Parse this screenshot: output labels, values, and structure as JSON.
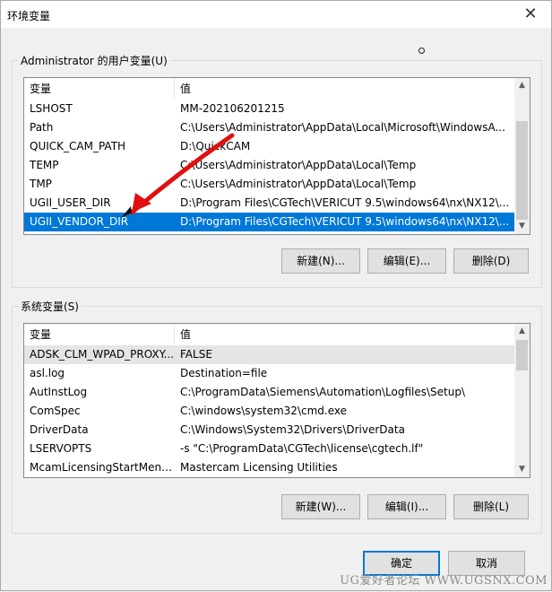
{
  "window": {
    "title": "环境变量",
    "close_glyph": "✕"
  },
  "user_group": {
    "label": "Administrator 的用户变量(U)",
    "col_name": "变量",
    "col_value": "值",
    "rows": [
      {
        "name": "LSHOST",
        "value": "MM-202106201215"
      },
      {
        "name": "Path",
        "value": "C:\\Users\\Administrator\\AppData\\Local\\Microsoft\\WindowsA..."
      },
      {
        "name": "QUICK_CAM_PATH",
        "value": "D:\\QuickCAM"
      },
      {
        "name": "TEMP",
        "value": "C:\\Users\\Administrator\\AppData\\Local\\Temp"
      },
      {
        "name": "TMP",
        "value": "C:\\Users\\Administrator\\AppData\\Local\\Temp"
      },
      {
        "name": "UGII_USER_DIR",
        "value": "D:\\Program Files\\CGTech\\VERICUT 9.5\\windows64\\nx\\NX12\\..."
      },
      {
        "name": "UGII_VENDOR_DIR",
        "value": "D:\\Program Files\\CGTech\\VERICUT 9.5\\windows64\\nx\\NX12\\..."
      }
    ],
    "new_label": "新建(N)...",
    "edit_label": "编辑(E)...",
    "delete_label": "删除(D)"
  },
  "system_group": {
    "label": "系统变量(S)",
    "col_name": "变量",
    "col_value": "值",
    "rows": [
      {
        "name": "ADSK_CLM_WPAD_PROXY...",
        "value": "FALSE"
      },
      {
        "name": "asl.log",
        "value": "Destination=file"
      },
      {
        "name": "AutInstLog",
        "value": "C:\\ProgramData\\Siemens\\Automation\\Logfiles\\Setup\\"
      },
      {
        "name": "ComSpec",
        "value": "C:\\windows\\system32\\cmd.exe"
      },
      {
        "name": "DriverData",
        "value": "C:\\Windows\\System32\\Drivers\\DriverData"
      },
      {
        "name": "LSERVOPTS",
        "value": "-s \"C:\\ProgramData\\CGTech\\license\\cgtech.lf\""
      },
      {
        "name": "McamLicensingStartMenu...",
        "value": "Mastercam Licensing Utilities"
      }
    ],
    "new_label": "新建(W)...",
    "edit_label": "编辑(I)...",
    "delete_label": "删除(L)"
  },
  "footer": {
    "ok_label": "确定",
    "cancel_label": "取消"
  },
  "watermark": "UG爱好者论坛 WWW.UGSNX.COM",
  "colors": {
    "selection": "#0078d7",
    "annotation_arrow": "#e01010"
  },
  "selected_user_row": 6,
  "hover_system_row": 0
}
